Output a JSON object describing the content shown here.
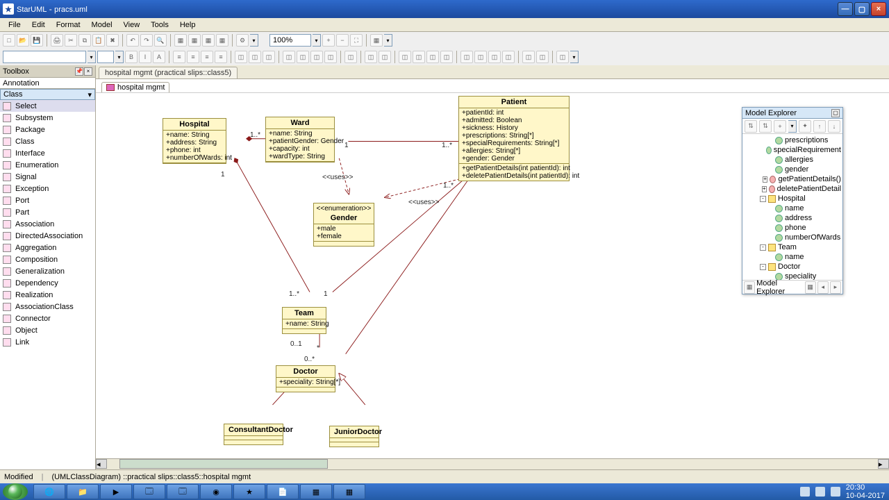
{
  "titlebar": {
    "app": "StarUML",
    "doc": "pracs.uml"
  },
  "menus": [
    "File",
    "Edit",
    "Format",
    "Model",
    "View",
    "Tools",
    "Help"
  ],
  "zoom": "100%",
  "toolbox": {
    "title": "Toolbox",
    "section_annotation": "Annotation",
    "section_class": "Class",
    "items": [
      "Select",
      "Subsystem",
      "Package",
      "Class",
      "Interface",
      "Enumeration",
      "Signal",
      "Exception",
      "Port",
      "Part",
      "Association",
      "DirectedAssociation",
      "Aggregation",
      "Composition",
      "Generalization",
      "Dependency",
      "Realization",
      "AssociationClass",
      "Connector",
      "Object",
      "Link"
    ]
  },
  "tabs": {
    "main": "hospital mgmt (practical slips::class5)",
    "sub": "hospital mgmt"
  },
  "uml": {
    "hospital": {
      "name": "Hospital",
      "attrs": [
        "+name: String",
        "+address: String",
        "+phone: int",
        "+numberOfWards: int"
      ]
    },
    "ward": {
      "name": "Ward",
      "attrs": [
        "+name: String",
        "+patientGender: Gender",
        "+capacity: int",
        "+wardType: String"
      ]
    },
    "patient": {
      "name": "Patient",
      "attrs": [
        "+patientId: int",
        "+admitted: Boolean",
        "+sickness: History",
        "+prescriptions: String[*]",
        "+specialRequirements: String[*]",
        "+allergies: String[*]",
        "+gender: Gender"
      ],
      "ops": [
        "+getPatientDetails(int patientId): int",
        "+deletePatientDetails(int patientId): int"
      ]
    },
    "gender": {
      "stereo": "<<enumeration>>",
      "name": "Gender",
      "lits": [
        "+male",
        "+female"
      ]
    },
    "team": {
      "name": "Team",
      "attrs": [
        "+name: String"
      ]
    },
    "doctor": {
      "name": "Doctor",
      "attrs": [
        "+speciality: String[*]"
      ]
    },
    "consultant": {
      "name": "ConsultantDoctor"
    },
    "junior": {
      "name": "JuniorDoctor"
    }
  },
  "labels": {
    "uses1": "<<uses>>",
    "uses2": "<<uses>>",
    "m_1": "1",
    "m_1star": "1..*",
    "m_0_1": "0..1",
    "m_0star": "0..*",
    "m_star": "*"
  },
  "explorer": {
    "title": "Model Explorer",
    "nodes": [
      {
        "ind": 3,
        "ic": "attr",
        "txt": "prescriptions"
      },
      {
        "ind": 3,
        "ic": "attr",
        "txt": "specialRequirement"
      },
      {
        "ind": 3,
        "ic": "attr",
        "txt": "allergies"
      },
      {
        "ind": 3,
        "ic": "attr",
        "txt": "gender"
      },
      {
        "ind": 3,
        "ic": "op",
        "exp": "+",
        "txt": "getPatientDetails()"
      },
      {
        "ind": 3,
        "ic": "op",
        "exp": "+",
        "txt": "deletePatientDetail"
      },
      {
        "ind": 2,
        "ic": "fold",
        "exp": "-",
        "txt": "Hospital"
      },
      {
        "ind": 3,
        "ic": "attr",
        "txt": "name"
      },
      {
        "ind": 3,
        "ic": "attr",
        "txt": "address"
      },
      {
        "ind": 3,
        "ic": "attr",
        "txt": "phone"
      },
      {
        "ind": 3,
        "ic": "attr",
        "txt": "numberOfWards"
      },
      {
        "ind": 2,
        "ic": "fold",
        "exp": "-",
        "txt": "Team"
      },
      {
        "ind": 3,
        "ic": "attr",
        "txt": "name"
      },
      {
        "ind": 2,
        "ic": "fold",
        "exp": "-",
        "txt": "Doctor"
      },
      {
        "ind": 3,
        "ic": "attr",
        "txt": "speciality"
      }
    ],
    "tab": "Model Explorer"
  },
  "status": {
    "modified": "Modified",
    "path": "(UMLClassDiagram) ::practical slips::class5::hospital mgmt"
  },
  "tray": {
    "time": "20:30",
    "date": "10-04-2017"
  }
}
